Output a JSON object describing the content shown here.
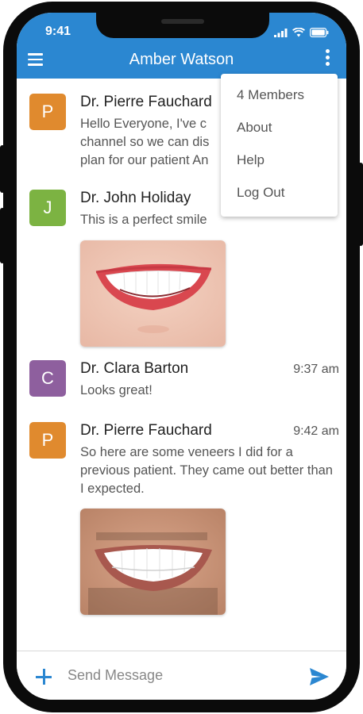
{
  "status_bar": {
    "time": "9:41"
  },
  "header": {
    "title": "Amber Watson"
  },
  "menu": {
    "items": [
      "4 Members",
      "About",
      "Help",
      "Log Out"
    ]
  },
  "messages": [
    {
      "initial": "P",
      "color": "#e08a2e",
      "name": "Dr. Pierre Fauchard",
      "time": "",
      "text": "Hello Everyone, I've c... channel so we can dis... plan for our patient Am..."
    },
    {
      "initial": "J",
      "color": "#7cb342",
      "name": "Dr. John Holiday",
      "time": "",
      "text": "This is a perfect smile"
    },
    {
      "initial": "C",
      "color": "#8e5f9e",
      "name": "Dr. Clara Barton",
      "time": "9:37 am",
      "text": "Looks great!"
    },
    {
      "initial": "P",
      "color": "#e08a2e",
      "name": "Dr. Pierre Fauchard",
      "time": "9:42 am",
      "text": "So here are some veneers I did for a previous patient. They came out better than I expected."
    }
  ],
  "first_message_lines": [
    "Hello Everyone, I've c",
    "channel so we can dis",
    "plan for our patient An"
  ],
  "composer": {
    "placeholder": "Send Message"
  },
  "colors": {
    "accent": "#2b87d1"
  },
  "icons": {
    "menu": "hamburger-icon",
    "more": "kebab-icon",
    "add": "plus-icon",
    "send": "send-icon"
  }
}
